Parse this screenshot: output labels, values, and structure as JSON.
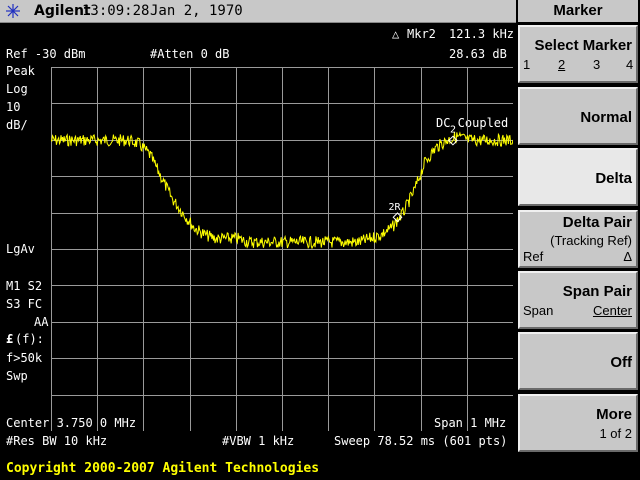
{
  "titlebar": {
    "brand": "Agilent",
    "time": "13:09:28",
    "date": "Jan 2, 1970"
  },
  "marker_readout": {
    "label": "Mkr2",
    "frequency": "121.3 kHz",
    "amplitude": "28.63 dB"
  },
  "header": {
    "ref_level": "Ref -30 dBm",
    "attenuation": "#Atten 0 dB"
  },
  "left_annotations": {
    "detector": "Peak",
    "scale": "Log",
    "scale_value": "10",
    "scale_unit": "dB/",
    "averaging": "LgAv",
    "m1s2": "M1  S2",
    "s3fc": "S3  FC",
    "aa": "AA",
    "ff": "(f):",
    "f_symbol": "£",
    "fgt": "f>50k",
    "swp": "Swp"
  },
  "coupling": "DC Coupled",
  "markers": {
    "m2_label": "2",
    "m2r_label": "2R"
  },
  "footer": {
    "center": "Center 3.750 0 MHz",
    "span": "Span 1 MHz",
    "rbw": "#Res BW 10 kHz",
    "vbw": "#VBW 1 kHz",
    "sweep": "Sweep 78.52 ms (601 pts)"
  },
  "copyright": "Copyright 2000-2007 Agilent Technologies",
  "softkeys": {
    "title": "Marker",
    "select_marker": {
      "label": "Select Marker",
      "options": [
        "1",
        "2",
        "3",
        "4"
      ],
      "selected": "2"
    },
    "normal": "Normal",
    "delta": "Delta",
    "delta_pair": {
      "label": "Delta Pair",
      "sub": "(Tracking Ref)",
      "left": "Ref",
      "right": "Δ"
    },
    "span_pair": {
      "label": "Span Pair",
      "left": "Span",
      "right": "Center"
    },
    "off": "Off",
    "more": {
      "label": "More",
      "sub": "1 of 2"
    }
  },
  "colors": {
    "trace": "#ffff00",
    "grid": "#9a9a9a",
    "panel": "#c8c8c8",
    "copyright": "#ffff00"
  },
  "trace_profile": {
    "shape": "band-reject notch",
    "samples_db": [
      -2,
      -2,
      -2,
      -2,
      -2,
      -2,
      -2,
      -2,
      -3,
      -6,
      -12,
      -18,
      -22,
      -26,
      -28,
      -29,
      -29,
      -29,
      -30,
      -30,
      -30,
      -30,
      -30,
      -30,
      -30,
      -30,
      -30,
      -30,
      -30,
      -29,
      -28,
      -26,
      -22,
      -16,
      -8,
      -4,
      -2,
      -1,
      -2,
      -2,
      -2,
      -2,
      -2
    ]
  }
}
